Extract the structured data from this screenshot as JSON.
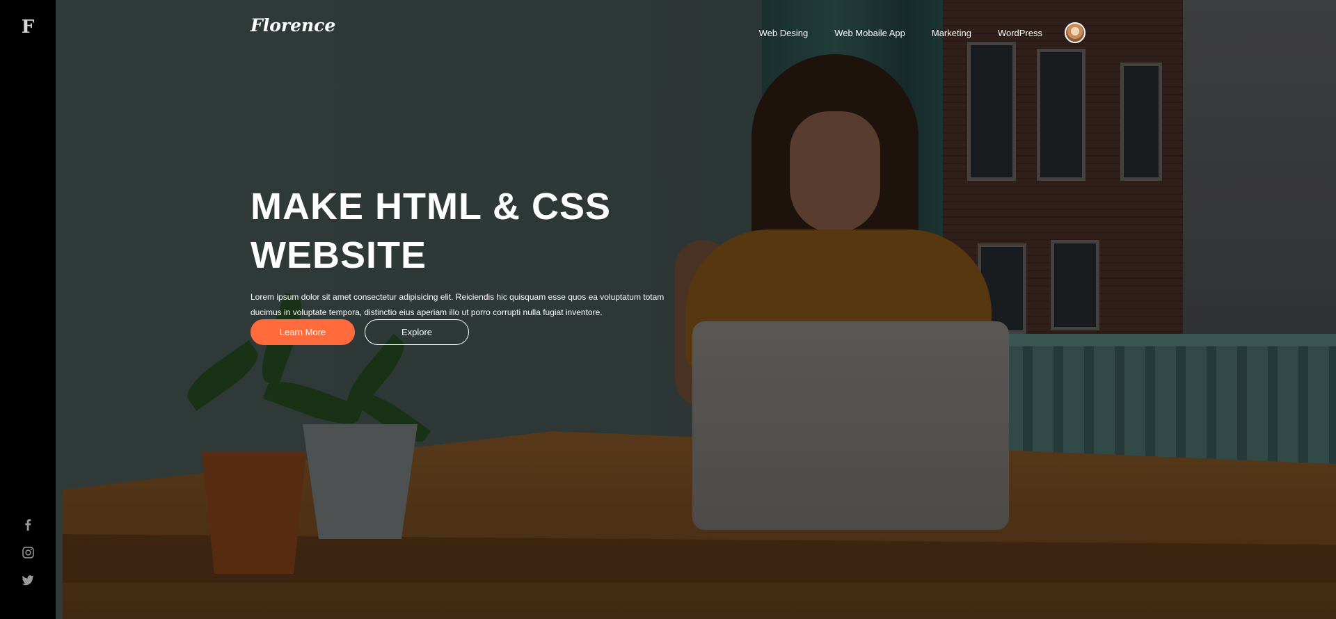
{
  "sidebar": {
    "logo": "F",
    "social": [
      {
        "icon": "facebook-icon"
      },
      {
        "icon": "instagram-icon"
      },
      {
        "icon": "twitter-icon"
      }
    ]
  },
  "header": {
    "brand": "Florence",
    "nav": [
      "Web Desing",
      "Web Mobaile App",
      "Marketing",
      "WordPress"
    ],
    "avatar": "user-avatar"
  },
  "hero": {
    "headline_line1": "MAKE HTML & CSS",
    "headline_line2": "WEBSITE",
    "blurb": "Lorem ipsum dolor sit amet consectetur adipisicing elit. Reiciendis hic quisquam esse quos ea voluptatum totam ducimus in voluptate tempora, distinctio eius aperiam illo ut porro corrupti nulla fugiat inventore.",
    "primary_button": "Learn More",
    "secondary_button": "Explore"
  },
  "colors": {
    "accent": "#ff6b3d",
    "sidebar": "#000000",
    "text": "#ffffff"
  }
}
